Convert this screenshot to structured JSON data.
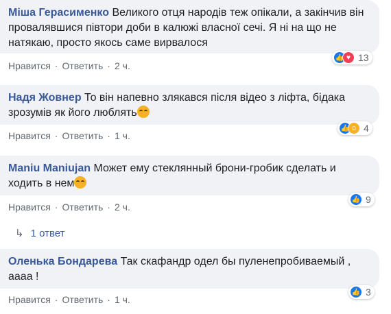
{
  "comments": [
    {
      "author": "Міша Герасименко",
      "text": "Великого отця народів теж опікали, а закінчив він провалявшися півтори доби в калюжі власної сечі. Я ні на що не натякаю, просто якось саме вирвалося",
      "like": "Нравится",
      "reply": "Ответить",
      "time": "2 ч.",
      "reactions": [
        "like",
        "love"
      ],
      "count": "13"
    },
    {
      "author": "Надя Жовнер",
      "text": "То він напевно злякався після відео з ліфта, бідака зрозумів як його люблять",
      "like": "Нравится",
      "reply": "Ответить",
      "time": "1 ч.",
      "reactions": [
        "like",
        "haha"
      ],
      "count": "4"
    },
    {
      "author": "Maniu Maniujan",
      "text": "Может ему стеклянный брони-гробик сделать и ходить в нем",
      "like": "Нравится",
      "reply": "Ответить",
      "time": "2 ч.",
      "reactions": [
        "like"
      ],
      "count": "9"
    },
    {
      "author": "Оленька Бондарева",
      "text": "Так скафандр одел бы пуленепробиваемый , аааа !",
      "like": "Нравится",
      "reply": "Ответить",
      "time": "1 ч.",
      "reactions": [
        "like"
      ],
      "count": "3"
    }
  ],
  "replies_link": "1 ответ",
  "colors": {
    "author": "#385898",
    "bubble": "#f0f2f5",
    "meta": "#606770",
    "like": "#1877f2",
    "love": "#f33e58",
    "haha": "#f7b125"
  }
}
